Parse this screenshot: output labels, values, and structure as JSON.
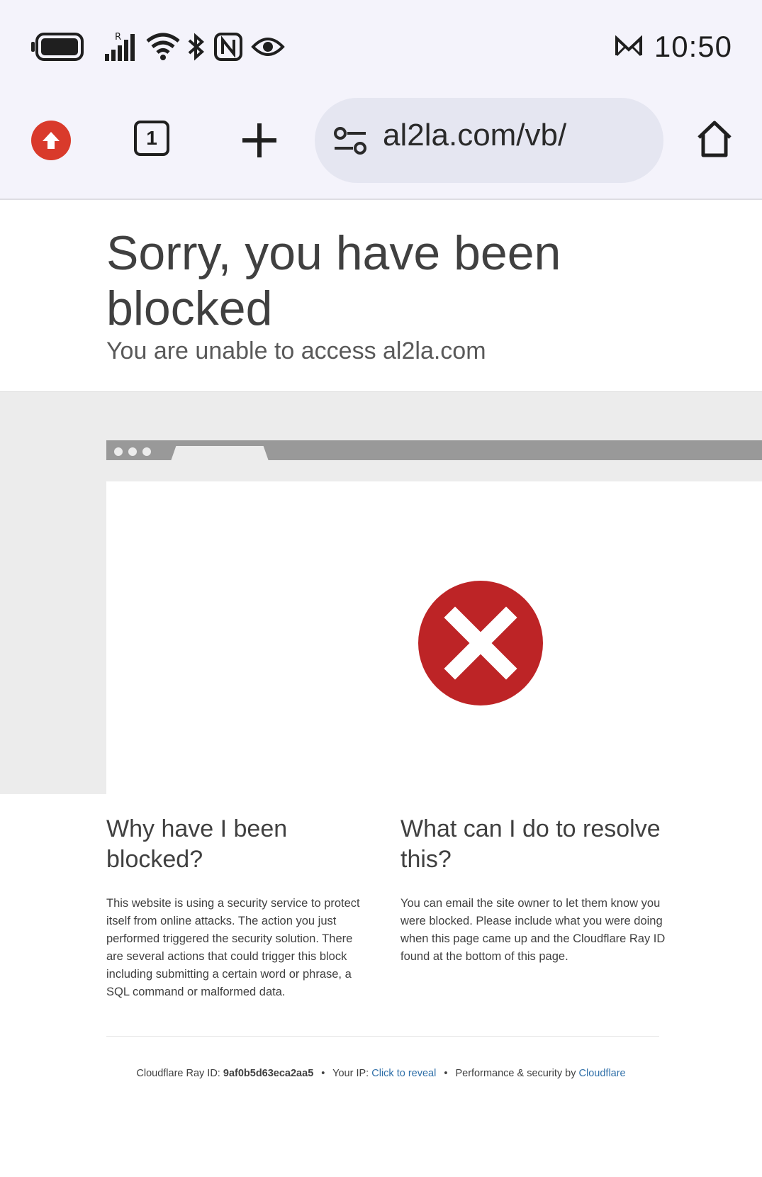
{
  "status_bar": {
    "time": "10:50",
    "icons": [
      "battery-icon",
      "signal-icon",
      "wifi-icon",
      "bluetooth-icon",
      "nfc-icon",
      "eye-icon",
      "mail-icon"
    ]
  },
  "toolbar": {
    "tab_count": "1",
    "url": "al2la.com/vb/"
  },
  "page": {
    "title": "Sorry, you have been blocked",
    "subtitle": "You are unable to access al2la.com",
    "why": {
      "heading": "Why have I been blocked?",
      "body": "This website is using a security service to protect itself from online attacks. The action you just performed triggered the security solution. There are several actions that could trigger this block including submitting a certain word or phrase, a SQL command or malformed data."
    },
    "resolve": {
      "heading": "What can I do to resolve this?",
      "body": "You can email the site owner to let them know you were blocked. Please include what you were doing when this page came up and the Cloudflare Ray ID found at the bottom of this page."
    },
    "footer": {
      "ray_label": "Cloudflare Ray ID:",
      "ray_id": "9af0b5d63eca2aa5",
      "ip_label": "Your IP:",
      "ip_link": "Click to reveal",
      "perf_label": "Performance & security by",
      "cf_link": "Cloudflare",
      "separator": "•"
    }
  },
  "colors": {
    "error_red": "#bd2426",
    "link_blue": "#2f6fa8",
    "upload_red": "#d93a2b"
  }
}
